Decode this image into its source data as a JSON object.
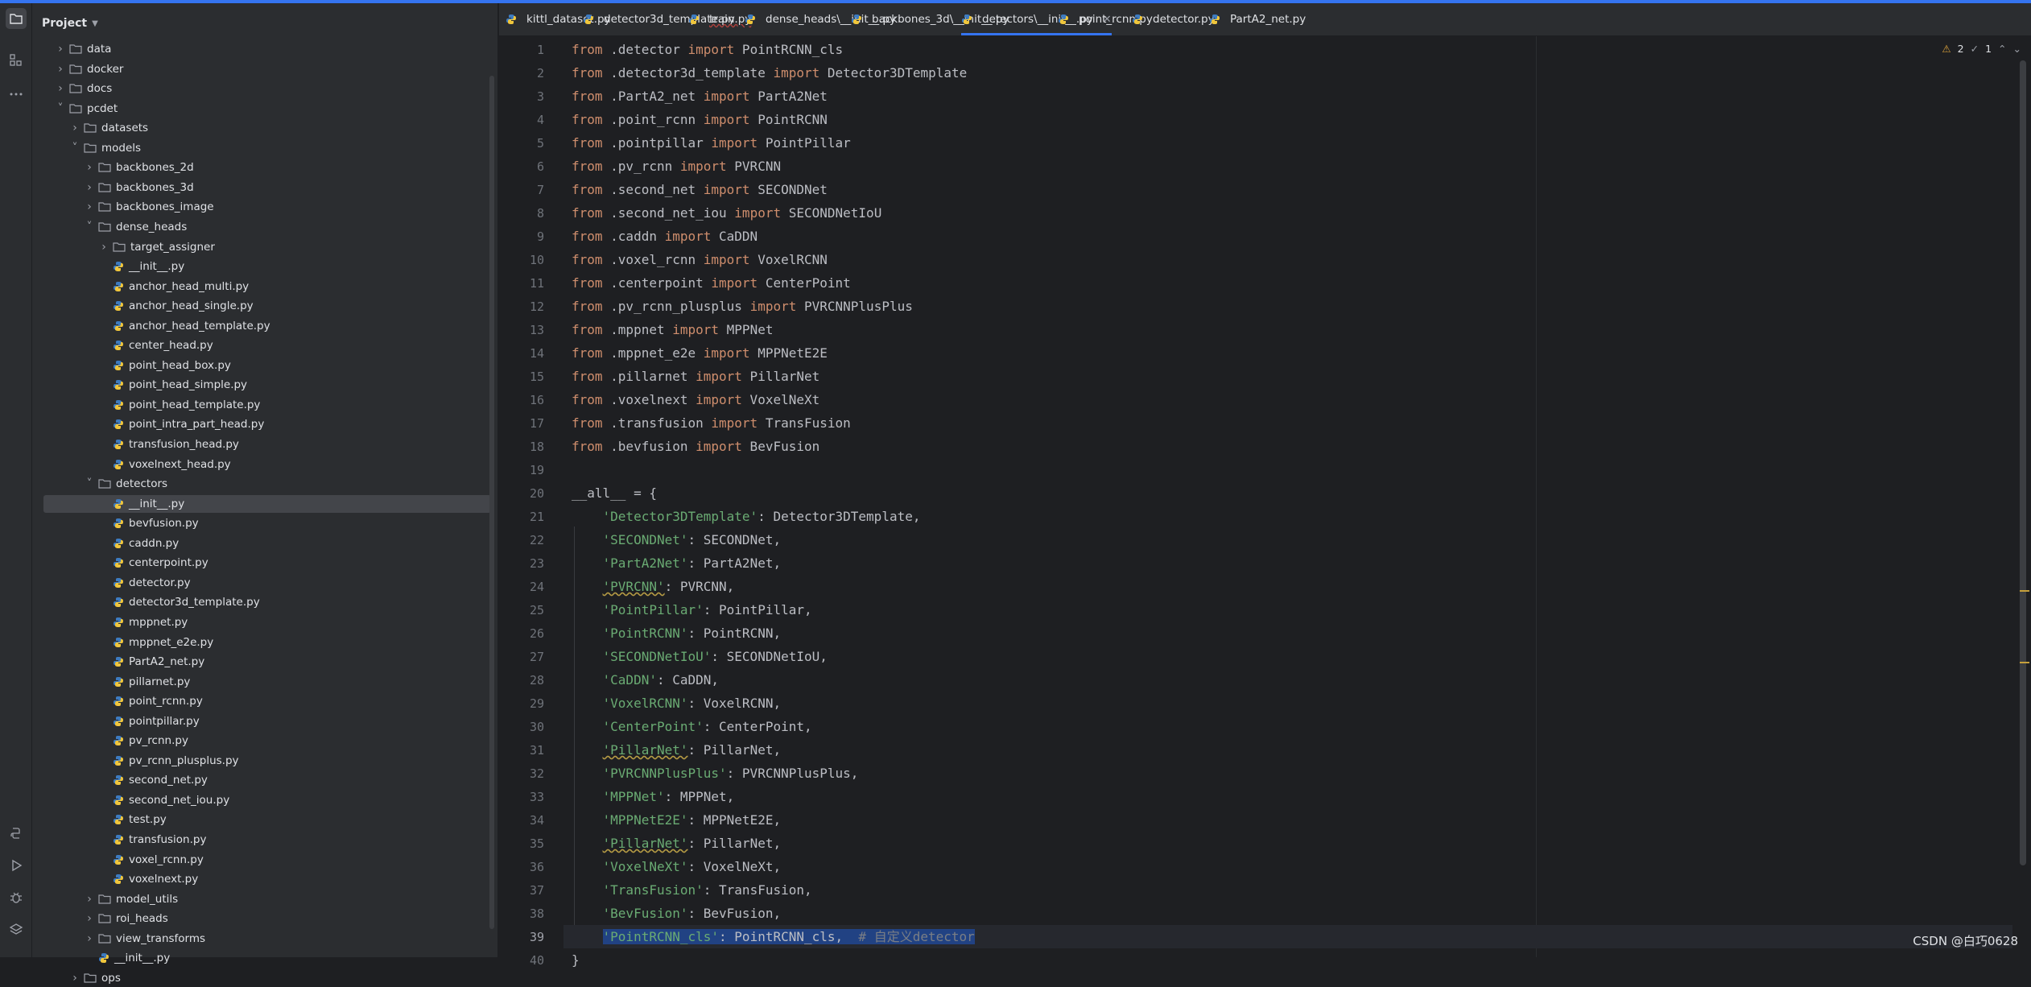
{
  "project": {
    "title": "Project",
    "tree": [
      {
        "label": "data",
        "kind": "folder",
        "depth": 1,
        "open": false
      },
      {
        "label": "docker",
        "kind": "folder",
        "depth": 1,
        "open": false
      },
      {
        "label": "docs",
        "kind": "folder",
        "depth": 1,
        "open": false
      },
      {
        "label": "pcdet",
        "kind": "folder",
        "depth": 1,
        "open": true
      },
      {
        "label": "datasets",
        "kind": "folder",
        "depth": 2,
        "open": false
      },
      {
        "label": "models",
        "kind": "folder",
        "depth": 2,
        "open": true
      },
      {
        "label": "backbones_2d",
        "kind": "folder",
        "depth": 3,
        "open": false
      },
      {
        "label": "backbones_3d",
        "kind": "folder",
        "depth": 3,
        "open": false
      },
      {
        "label": "backbones_image",
        "kind": "folder",
        "depth": 3,
        "open": false
      },
      {
        "label": "dense_heads",
        "kind": "folder",
        "depth": 3,
        "open": true
      },
      {
        "label": "target_assigner",
        "kind": "folder",
        "depth": 4,
        "open": false
      },
      {
        "label": "__init__.py",
        "kind": "file",
        "depth": 4
      },
      {
        "label": "anchor_head_multi.py",
        "kind": "file",
        "depth": 4
      },
      {
        "label": "anchor_head_single.py",
        "kind": "file",
        "depth": 4
      },
      {
        "label": "anchor_head_template.py",
        "kind": "file",
        "depth": 4
      },
      {
        "label": "center_head.py",
        "kind": "file",
        "depth": 4
      },
      {
        "label": "point_head_box.py",
        "kind": "file",
        "depth": 4
      },
      {
        "label": "point_head_simple.py",
        "kind": "file",
        "depth": 4
      },
      {
        "label": "point_head_template.py",
        "kind": "file",
        "depth": 4
      },
      {
        "label": "point_intra_part_head.py",
        "kind": "file",
        "depth": 4
      },
      {
        "label": "transfusion_head.py",
        "kind": "file",
        "depth": 4
      },
      {
        "label": "voxelnext_head.py",
        "kind": "file",
        "depth": 4
      },
      {
        "label": "detectors",
        "kind": "folder",
        "depth": 3,
        "open": true
      },
      {
        "label": "__init__.py",
        "kind": "file",
        "depth": 4,
        "selected": true
      },
      {
        "label": "bevfusion.py",
        "kind": "file",
        "depth": 4
      },
      {
        "label": "caddn.py",
        "kind": "file",
        "depth": 4
      },
      {
        "label": "centerpoint.py",
        "kind": "file",
        "depth": 4
      },
      {
        "label": "detector.py",
        "kind": "file",
        "depth": 4
      },
      {
        "label": "detector3d_template.py",
        "kind": "file",
        "depth": 4
      },
      {
        "label": "mppnet.py",
        "kind": "file",
        "depth": 4
      },
      {
        "label": "mppnet_e2e.py",
        "kind": "file",
        "depth": 4
      },
      {
        "label": "PartA2_net.py",
        "kind": "file",
        "depth": 4
      },
      {
        "label": "pillarnet.py",
        "kind": "file",
        "depth": 4
      },
      {
        "label": "point_rcnn.py",
        "kind": "file",
        "depth": 4
      },
      {
        "label": "pointpillar.py",
        "kind": "file",
        "depth": 4
      },
      {
        "label": "pv_rcnn.py",
        "kind": "file",
        "depth": 4
      },
      {
        "label": "pv_rcnn_plusplus.py",
        "kind": "file",
        "depth": 4
      },
      {
        "label": "second_net.py",
        "kind": "file",
        "depth": 4
      },
      {
        "label": "second_net_iou.py",
        "kind": "file",
        "depth": 4
      },
      {
        "label": "test.py",
        "kind": "file",
        "depth": 4
      },
      {
        "label": "transfusion.py",
        "kind": "file",
        "depth": 4
      },
      {
        "label": "voxel_rcnn.py",
        "kind": "file",
        "depth": 4
      },
      {
        "label": "voxelnext.py",
        "kind": "file",
        "depth": 4
      },
      {
        "label": "model_utils",
        "kind": "folder",
        "depth": 3,
        "open": false
      },
      {
        "label": "roi_heads",
        "kind": "folder",
        "depth": 3,
        "open": false
      },
      {
        "label": "view_transforms",
        "kind": "folder",
        "depth": 3,
        "open": false
      },
      {
        "label": "__init__.py",
        "kind": "file",
        "depth": 3
      },
      {
        "label": "ops",
        "kind": "folder",
        "depth": 2,
        "open": false
      }
    ]
  },
  "tabs": [
    {
      "label": "kittl_dataset.py"
    },
    {
      "label": "detector3d_template.py"
    },
    {
      "label": "train.py"
    },
    {
      "label": "dense_heads\\__init__.py"
    },
    {
      "label": "backbones_3d\\__init__.py"
    },
    {
      "label": "detectors\\__init__.py",
      "active": true
    },
    {
      "label": "point_rcnn.py"
    },
    {
      "label": "detector.py"
    },
    {
      "label": "PartA2_net.py"
    }
  ],
  "inspections": {
    "warnings": "2",
    "weak": "1"
  },
  "code": [
    [
      [
        "kw",
        "from"
      ],
      [
        "p",
        " .detector "
      ],
      [
        "kw",
        "import"
      ],
      [
        "p",
        " PointRCNN_cls"
      ]
    ],
    [
      [
        "kw",
        "from"
      ],
      [
        "p",
        " .detector3d_template "
      ],
      [
        "kw",
        "import"
      ],
      [
        "p",
        " Detector3DTemplate"
      ]
    ],
    [
      [
        "kw",
        "from"
      ],
      [
        "p",
        " .PartA2_net "
      ],
      [
        "kw",
        "import"
      ],
      [
        "p",
        " PartA2Net"
      ]
    ],
    [
      [
        "kw",
        "from"
      ],
      [
        "p",
        " .point_rcnn "
      ],
      [
        "kw",
        "import"
      ],
      [
        "p",
        " PointRCNN"
      ]
    ],
    [
      [
        "kw",
        "from"
      ],
      [
        "p",
        " .pointpillar "
      ],
      [
        "kw",
        "import"
      ],
      [
        "p",
        " PointPillar"
      ]
    ],
    [
      [
        "kw",
        "from"
      ],
      [
        "p",
        " .pv_rcnn "
      ],
      [
        "kw",
        "import"
      ],
      [
        "p",
        " PVRCNN"
      ]
    ],
    [
      [
        "kw",
        "from"
      ],
      [
        "p",
        " .second_net "
      ],
      [
        "kw",
        "import"
      ],
      [
        "p",
        " SECONDNet"
      ]
    ],
    [
      [
        "kw",
        "from"
      ],
      [
        "p",
        " .second_net_iou "
      ],
      [
        "kw",
        "import"
      ],
      [
        "p",
        " SECONDNetIoU"
      ]
    ],
    [
      [
        "kw",
        "from"
      ],
      [
        "p",
        " .caddn "
      ],
      [
        "kw",
        "import"
      ],
      [
        "p",
        " CaDDN"
      ]
    ],
    [
      [
        "kw",
        "from"
      ],
      [
        "p",
        " .voxel_rcnn "
      ],
      [
        "kw",
        "import"
      ],
      [
        "p",
        " VoxelRCNN"
      ]
    ],
    [
      [
        "kw",
        "from"
      ],
      [
        "p",
        " .centerpoint "
      ],
      [
        "kw",
        "import"
      ],
      [
        "p",
        " CenterPoint"
      ]
    ],
    [
      [
        "kw",
        "from"
      ],
      [
        "p",
        " .pv_rcnn_plusplus "
      ],
      [
        "kw",
        "import"
      ],
      [
        "p",
        " PVRCNNPlusPlus"
      ]
    ],
    [
      [
        "kw",
        "from"
      ],
      [
        "p",
        " .mppnet "
      ],
      [
        "kw",
        "import"
      ],
      [
        "p",
        " MPPNet"
      ]
    ],
    [
      [
        "kw",
        "from"
      ],
      [
        "p",
        " .mppnet_e2e "
      ],
      [
        "kw",
        "import"
      ],
      [
        "p",
        " MPPNetE2E"
      ]
    ],
    [
      [
        "kw",
        "from"
      ],
      [
        "p",
        " .pillarnet "
      ],
      [
        "kw",
        "import"
      ],
      [
        "p",
        " PillarNet"
      ]
    ],
    [
      [
        "kw",
        "from"
      ],
      [
        "p",
        " .voxelnext "
      ],
      [
        "kw",
        "import"
      ],
      [
        "p",
        " VoxelNeXt"
      ]
    ],
    [
      [
        "kw",
        "from"
      ],
      [
        "p",
        " .transfusion "
      ],
      [
        "kw",
        "import"
      ],
      [
        "p",
        " TransFusion"
      ]
    ],
    [
      [
        "kw",
        "from"
      ],
      [
        "p",
        " .bevfusion "
      ],
      [
        "kw",
        "import"
      ],
      [
        "p",
        " BevFusion"
      ]
    ],
    [],
    [
      [
        "p",
        "__all__ = {"
      ]
    ],
    [
      [
        "p",
        "    "
      ],
      [
        "str",
        "'Detector3DTemplate'"
      ],
      [
        "p",
        ": Detector3DTemplate,"
      ]
    ],
    [
      [
        "p",
        "    "
      ],
      [
        "str",
        "'SECONDNet'"
      ],
      [
        "p",
        ": SECONDNet,"
      ]
    ],
    [
      [
        "p",
        "    "
      ],
      [
        "str",
        "'PartA2Net'"
      ],
      [
        "p",
        ": PartA2Net,"
      ]
    ],
    [
      [
        "p",
        "    "
      ],
      [
        "strw",
        "'PVRCNN'"
      ],
      [
        "p",
        ": PVRCNN,"
      ]
    ],
    [
      [
        "p",
        "    "
      ],
      [
        "str",
        "'PointPillar'"
      ],
      [
        "p",
        ": PointPillar,"
      ]
    ],
    [
      [
        "p",
        "    "
      ],
      [
        "str",
        "'PointRCNN'"
      ],
      [
        "p",
        ": PointRCNN,"
      ]
    ],
    [
      [
        "p",
        "    "
      ],
      [
        "str",
        "'SECONDNetIoU'"
      ],
      [
        "p",
        ": SECONDNetIoU,"
      ]
    ],
    [
      [
        "p",
        "    "
      ],
      [
        "str",
        "'CaDDN'"
      ],
      [
        "p",
        ": CaDDN,"
      ]
    ],
    [
      [
        "p",
        "    "
      ],
      [
        "str",
        "'VoxelRCNN'"
      ],
      [
        "p",
        ": VoxelRCNN,"
      ]
    ],
    [
      [
        "p",
        "    "
      ],
      [
        "str",
        "'CenterPoint'"
      ],
      [
        "p",
        ": CenterPoint,"
      ]
    ],
    [
      [
        "p",
        "    "
      ],
      [
        "strw",
        "'PillarNet'"
      ],
      [
        "p",
        ": PillarNet,"
      ]
    ],
    [
      [
        "p",
        "    "
      ],
      [
        "str",
        "'PVRCNNPlusPlus'"
      ],
      [
        "p",
        ": PVRCNNPlusPlus,"
      ]
    ],
    [
      [
        "p",
        "    "
      ],
      [
        "str",
        "'MPPNet'"
      ],
      [
        "p",
        ": MPPNet,"
      ]
    ],
    [
      [
        "p",
        "    "
      ],
      [
        "str",
        "'MPPNetE2E'"
      ],
      [
        "p",
        ": MPPNetE2E,"
      ]
    ],
    [
      [
        "p",
        "    "
      ],
      [
        "strw",
        "'PillarNet'"
      ],
      [
        "p",
        ": PillarNet,"
      ]
    ],
    [
      [
        "p",
        "    "
      ],
      [
        "str",
        "'VoxelNeXt'"
      ],
      [
        "p",
        ": VoxelNeXt,"
      ]
    ],
    [
      [
        "p",
        "    "
      ],
      [
        "str",
        "'TransFusion'"
      ],
      [
        "p",
        ": TransFusion,"
      ]
    ],
    [
      [
        "p",
        "    "
      ],
      [
        "str",
        "'BevFusion'"
      ],
      [
        "p",
        ": BevFusion,"
      ]
    ],
    [
      [
        "p",
        "    "
      ],
      [
        "sel_str",
        "'PointRCNN_cls'"
      ],
      [
        "sel",
        ": PointRCNN_cls,  "
      ],
      [
        "sel_cm",
        "# 自定义detector"
      ]
    ],
    [
      [
        "p",
        "}"
      ]
    ]
  ],
  "current_line": 39,
  "watermark": "CSDN @白巧0628",
  "colors": {
    "keyword": "#cf8e6d",
    "string": "#6aab73",
    "comment": "#7a7e85",
    "selection": "#214283",
    "accent": "#3574f0"
  }
}
